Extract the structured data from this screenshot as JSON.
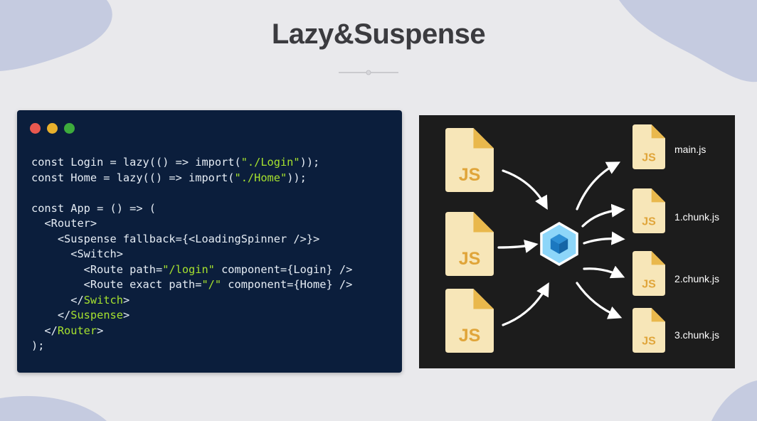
{
  "slide": {
    "title": "Lazy&Suspense"
  },
  "colors": {
    "background": "#e9e9ec",
    "blob": "#c5cbe0",
    "code_bg": "#0b1e3c",
    "code_text": "#e6edf5",
    "code_string": "#a6e22e",
    "dot_red": "#e9584f",
    "dot_yellow": "#e8b02c",
    "dot_green": "#3dab3c",
    "diagram_bg": "#1c1c1c",
    "file_body": "#f7e6b8",
    "file_corner": "#e9b84c",
    "file_text": "#e0a53a",
    "webpack_outer": "#8dd6f9",
    "webpack_inner": "#1c78c0"
  },
  "code_window": {
    "lines": [
      [
        {
          "t": "const Login = lazy(() => import(",
          "c": "kw"
        },
        {
          "t": "\"./Login\"",
          "c": "str"
        },
        {
          "t": "));",
          "c": "kw"
        }
      ],
      [
        {
          "t": "const Home = lazy(() => import(",
          "c": "kw"
        },
        {
          "t": "\"./Home\"",
          "c": "str"
        },
        {
          "t": "));",
          "c": "kw"
        }
      ],
      [],
      [
        {
          "t": "const App = () => (",
          "c": "kw"
        }
      ],
      [
        {
          "t": "  <Router>",
          "c": "tag"
        }
      ],
      [
        {
          "t": "    <Suspense fallback={<LoadingSpinner />}>",
          "c": "tag"
        }
      ],
      [
        {
          "t": "      <Switch>",
          "c": "tag"
        }
      ],
      [
        {
          "t": "        <Route path=",
          "c": "tag"
        },
        {
          "t": "\"/login\"",
          "c": "str"
        },
        {
          "t": " component={Login} />",
          "c": "tag"
        }
      ],
      [
        {
          "t": "        <Route exact path=",
          "c": "tag"
        },
        {
          "t": "\"/\"",
          "c": "str"
        },
        {
          "t": " component={Home} />",
          "c": "tag"
        }
      ],
      [
        {
          "t": "      </",
          "c": "tag"
        },
        {
          "t": "Switch",
          "c": "close"
        },
        {
          "t": ">",
          "c": "tag"
        }
      ],
      [
        {
          "t": "    </",
          "c": "tag"
        },
        {
          "t": "Suspense",
          "c": "close"
        },
        {
          "t": ">",
          "c": "tag"
        }
      ],
      [
        {
          "t": "  </",
          "c": "tag"
        },
        {
          "t": "Router",
          "c": "close"
        },
        {
          "t": ">",
          "c": "tag"
        }
      ],
      [
        {
          "t": ");",
          "c": "kw"
        }
      ]
    ]
  },
  "diagram": {
    "input_files": [
      {
        "label": "JS"
      },
      {
        "label": "JS"
      },
      {
        "label": "JS"
      }
    ],
    "bundler": {
      "icon": "webpack-icon"
    },
    "output_files": [
      {
        "icon_label": "JS",
        "name": "main.js"
      },
      {
        "icon_label": "JS",
        "name": "1.chunk.js"
      },
      {
        "icon_label": "JS",
        "name": "2.chunk.js"
      },
      {
        "icon_label": "JS",
        "name": "3.chunk.js"
      }
    ]
  }
}
